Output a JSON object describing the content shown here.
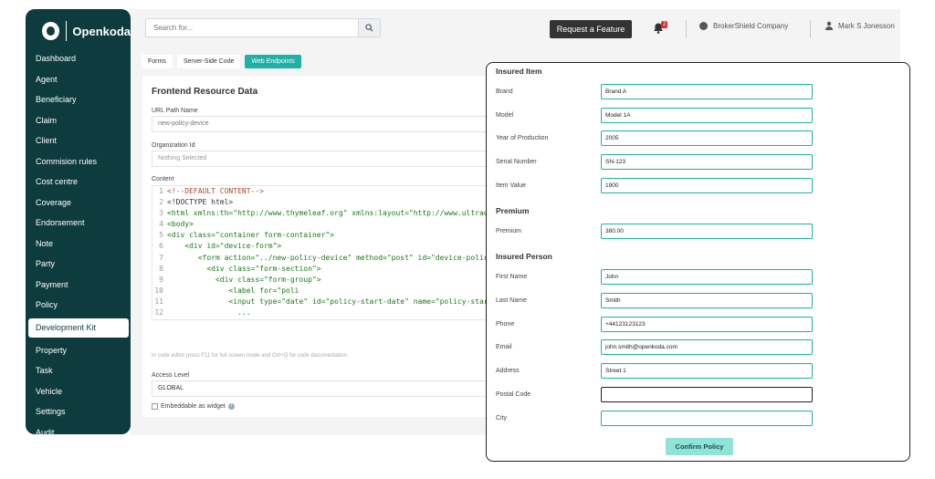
{
  "brand": {
    "logo_text": "Openkoda"
  },
  "sidebar": {
    "items": [
      {
        "label": "Dashboard"
      },
      {
        "label": "Agent"
      },
      {
        "label": "Beneficiary"
      },
      {
        "label": "Claim"
      },
      {
        "label": "Client"
      },
      {
        "label": "Commision rules"
      },
      {
        "label": "Cost centre"
      },
      {
        "label": "Coverage"
      },
      {
        "label": "Endorsement"
      },
      {
        "label": "Note"
      },
      {
        "label": "Party"
      },
      {
        "label": "Payment"
      },
      {
        "label": "Policy"
      },
      {
        "label": "Development Kit"
      },
      {
        "label": "Property"
      },
      {
        "label": "Task"
      },
      {
        "label": "Vehicle"
      },
      {
        "label": "Settings"
      },
      {
        "label": "Audit"
      }
    ],
    "active_index": 13
  },
  "topbar": {
    "search_placeholder": "Search for...",
    "request_feature_label": "Request a Feature",
    "notification_count": "2",
    "company": "BrokerShield Company",
    "user": "Mark S Jonesson"
  },
  "tabs": [
    {
      "label": "Forms",
      "active": false
    },
    {
      "label": "Server-Side Code",
      "active": false
    },
    {
      "label": "Web Endpoints",
      "active": true
    }
  ],
  "card": {
    "title": "Frontend Resource Data",
    "url_label": "URL Path Name",
    "url_value": "new-policy-device",
    "org_label": "Organization Id",
    "org_value": "Nothing Selected",
    "content_label": "Content",
    "code_lines": [
      "<!--DEFAULT CONTENT-->",
      "<!DOCTYPE html>",
      "<html xmlns:th=\"http://www.thymeleaf.org\" xmlns:layout=\"http://www.ultraq",
      "<body>",
      "<div class=\"container form-container\">",
      "    <div id=\"device-form\">",
      "       <form action=\"../new-policy-device\" method=\"post\" id=\"device-polic",
      "         <div class=\"form-section\">",
      "           <div class=\"form-group\">",
      "              <label for=\"poli",
      "              <input type=\"date\" id=\"policy-start-date\" name=\"policy-start",
      "                ..."
    ],
    "editor_hint": "In code editor press F11 for full screen mode and Ctrl+Q for code documentation.",
    "access_label": "Access Level",
    "access_value": "GLOBAL",
    "embeddable_label": "Embeddable as widget"
  },
  "overlay": {
    "insured_item_title": "Insured Item",
    "fields_item": [
      {
        "label": "Brand",
        "value": "Brand A"
      },
      {
        "label": "Model",
        "value": "Model 1A"
      },
      {
        "label": "Year of Production",
        "value": "2005"
      },
      {
        "label": "Serial Number",
        "value": "SN-123"
      },
      {
        "label": "Item Value",
        "value": "1900"
      }
    ],
    "premium_title": "Premium",
    "premium_label": "Premium",
    "premium_value": "380.00",
    "insured_person_title": "Insured Person",
    "fields_person": [
      {
        "label": "First Name",
        "value": "John"
      },
      {
        "label": "Last Name",
        "value": "Smith"
      },
      {
        "label": "Phone",
        "value": "+44123123123"
      },
      {
        "label": "Email",
        "value": "john.smith@openkoda.com"
      },
      {
        "label": "Address",
        "value": "Street 1"
      },
      {
        "label": "Postal Code",
        "value": ""
      },
      {
        "label": "City",
        "value": ""
      }
    ],
    "confirm_label": "Confirm Policy"
  },
  "colors": {
    "sidebar": "#0e3b3d",
    "accent": "#1fb0a6",
    "confirm": "#8fe3d9"
  }
}
